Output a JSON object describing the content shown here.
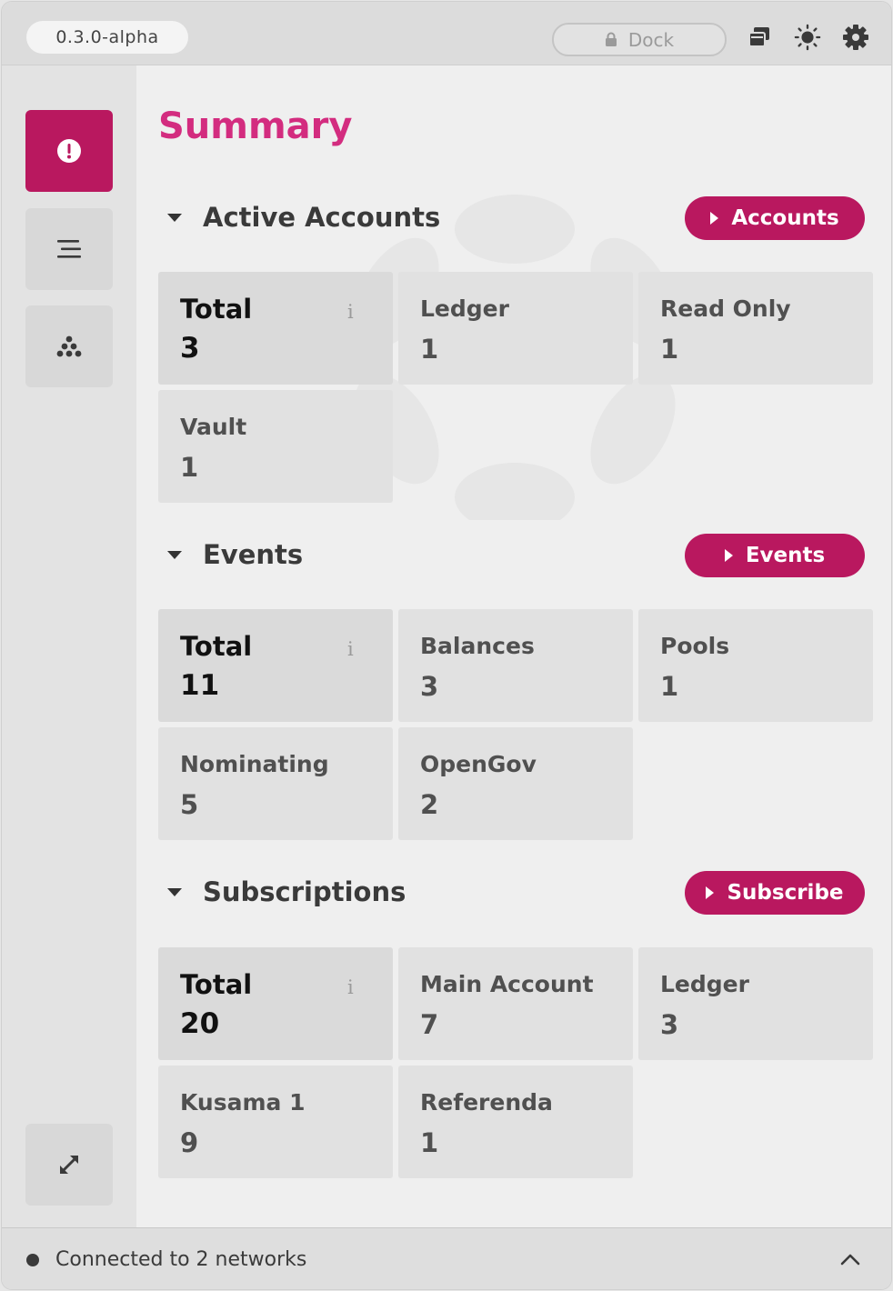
{
  "header": {
    "version": "0.3.0-alpha",
    "dock_label": "Dock",
    "icons": [
      "copy-windows-icon",
      "sun-icon",
      "gear-icon"
    ]
  },
  "sidebar": {
    "items": [
      {
        "name": "summary",
        "icon": "alert-circle-icon",
        "active": true
      },
      {
        "name": "events",
        "icon": "lines-icon",
        "active": false
      },
      {
        "name": "subscriptions",
        "icon": "stack-icon",
        "active": false
      }
    ],
    "expand_icon": "expand-arrows-icon"
  },
  "main": {
    "title": "Summary",
    "sections": [
      {
        "title": "Active Accounts",
        "button": "Accounts",
        "cards": [
          {
            "label": "Total",
            "value": "3"
          },
          {
            "label": "Ledger",
            "value": "1"
          },
          {
            "label": "Read Only",
            "value": "1"
          },
          {
            "label": "Vault",
            "value": "1"
          }
        ]
      },
      {
        "title": "Events",
        "button": "Events",
        "cards": [
          {
            "label": "Total",
            "value": "11"
          },
          {
            "label": "Balances",
            "value": "3"
          },
          {
            "label": "Pools",
            "value": "1"
          },
          {
            "label": "Nominating",
            "value": "5"
          },
          {
            "label": "OpenGov",
            "value": "2"
          }
        ]
      },
      {
        "title": "Subscriptions",
        "button": "Subscribe",
        "cards": [
          {
            "label": "Total",
            "value": "20"
          },
          {
            "label": "Main Account",
            "value": "7"
          },
          {
            "label": "Ledger",
            "value": "3"
          },
          {
            "label": "Kusama 1",
            "value": "9"
          },
          {
            "label": "Referenda",
            "value": "1"
          }
        ]
      }
    ],
    "info_glyph": "i"
  },
  "footer": {
    "status": "Connected to 2 networks"
  },
  "colors": {
    "accent": "#b9185f",
    "title": "#d32c7f"
  }
}
